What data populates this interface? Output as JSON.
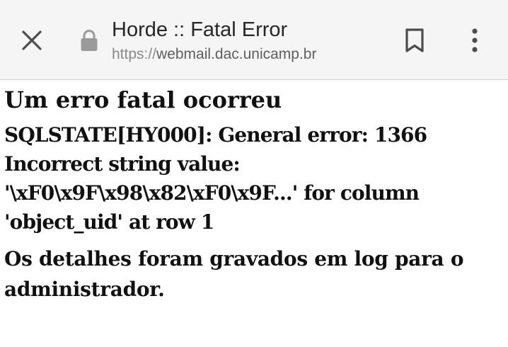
{
  "browser": {
    "title": "Horde :: Fatal Error",
    "url_scheme": "https://",
    "url_host": "webmail.dac.unicamp.br",
    "icons": {
      "close": "close-icon",
      "lock": "lock-icon",
      "bookmark": "bookmark-icon",
      "menu": "more-vert-icon"
    }
  },
  "page": {
    "heading": "Um erro fatal ocorreu",
    "error_message": "SQLSTATE[HY000]: General error: 1366 Incorrect string value: '\\xF0\\x9F\\x98\\x82\\xF0\\x9F...' for column 'object_uid' at row 1",
    "log_note": "Os detalhes foram gravados em log para o administrador."
  }
}
